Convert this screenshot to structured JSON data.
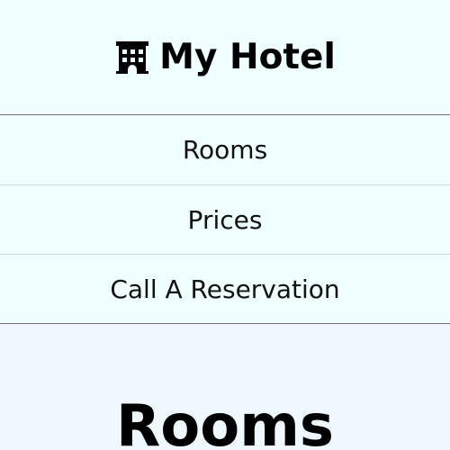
{
  "header": {
    "icon": "hotel-building-icon",
    "title": "My Hotel"
  },
  "nav": {
    "items": [
      {
        "label": "Rooms"
      },
      {
        "label": "Prices"
      },
      {
        "label": "Call A Reservation"
      }
    ]
  },
  "main": {
    "section_title": "Rooms"
  },
  "colors": {
    "header_bg": "#f0ffff",
    "main_bg": "#f0f8ff",
    "text": "#000000"
  }
}
